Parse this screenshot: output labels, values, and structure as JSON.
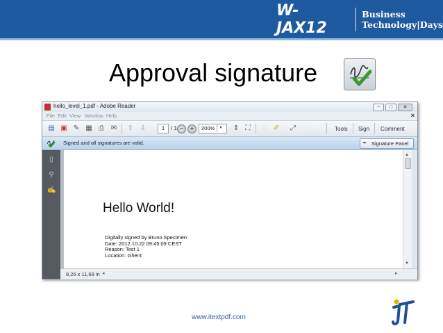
{
  "header": {
    "brand_logo": "W-JAX12",
    "brand_line1": "Business",
    "brand_line2": "Technology|Days"
  },
  "slide": {
    "title": "Approval signature"
  },
  "reader": {
    "window_title": "hello_level_1.pdf - Adobe Reader",
    "window_controls": [
      "−",
      "□",
      "✕"
    ],
    "menu": [
      "File",
      "Edit",
      "View",
      "Window",
      "Help"
    ],
    "menu_close": "×",
    "toolbar": {
      "page_current": "1",
      "page_total": "/ 1",
      "zoom": "200%",
      "zoom_dropdown": "▾",
      "tabs": [
        "Tools",
        "Sign",
        "Comment"
      ]
    },
    "signature_bar": {
      "message": "Signed and all signatures are valid.",
      "panel_button": "Signature Panel"
    },
    "document": {
      "heading": "Hello World!",
      "signature_lines": [
        "Digitally signed by Bruno Specimen",
        "Date: 2012.10.22 09:45:09 CEST",
        "Reason: Test 1",
        "Location: Ghent"
      ]
    },
    "status": {
      "page_size": "8,26 x 11,69 in"
    }
  },
  "footer": {
    "url": "www.itextpdf.com"
  },
  "colors": {
    "header_blue": "#1e5aa0",
    "signature_bar": "#c6dcf1",
    "nav_panel": "#555a60"
  }
}
